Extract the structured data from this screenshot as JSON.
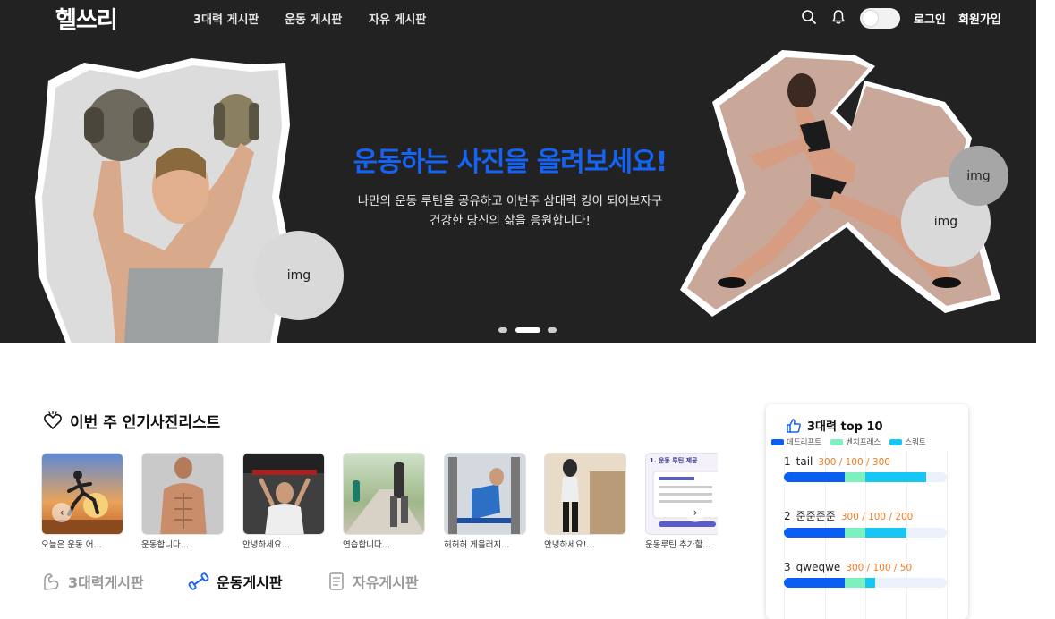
{
  "nav": {
    "logo": "헬쓰리",
    "links": [
      "3대력 게시판",
      "운동 게시판",
      "자유 게시판"
    ],
    "login": "로그인",
    "signup": "회원가입",
    "icons": [
      "search-icon",
      "bell-icon",
      "theme-toggle"
    ]
  },
  "hero": {
    "title": "운동하는 사진을 올려보세요!",
    "subtitle_line1": "나만의 운동 루틴을 공유하고 이번주 삼대력 킹이 되어보자구",
    "subtitle_line2": "건강한 당신의 삶을 응원합니다!",
    "img_labels": [
      "img",
      "img",
      "img"
    ],
    "active_slide": 1,
    "slide_count": 3
  },
  "popular": {
    "title": "이번 주 인기사진리스트",
    "items": [
      {
        "caption": "오늘은 운동 어..."
      },
      {
        "caption": "운동합니다..."
      },
      {
        "caption": "안녕하세요..."
      },
      {
        "caption": "연습합니다..."
      },
      {
        "caption": "허허허 게을러지..."
      },
      {
        "caption": "안녕하세요!..."
      },
      {
        "caption": "운동루틴 추가할..."
      }
    ],
    "prev": "‹",
    "next": "›",
    "last_thumb_text": "1. 운동 루틴 제공"
  },
  "tabs": {
    "items": [
      "3대력게시판",
      "운동게시판",
      "자유게시판"
    ],
    "active": 1
  },
  "top10": {
    "title": "3대력 top 10",
    "legend": [
      {
        "label": "데드리프트",
        "color": "#0a5ff2"
      },
      {
        "label": "벤치프레스",
        "color": "#7df0c0"
      },
      {
        "label": "스쿼트",
        "color": "#16c6f5"
      }
    ],
    "ranks": [
      {
        "rank": "1",
        "name": "tail",
        "values": "300 / 100 / 300",
        "dead": 300,
        "bench": 100,
        "squat": 300
      },
      {
        "rank": "2",
        "name": "준준준준",
        "values": "300 / 100 / 200",
        "dead": 300,
        "bench": 100,
        "squat": 200
      },
      {
        "rank": "3",
        "name": "qweqwe",
        "values": "300 / 100 / 50",
        "dead": 300,
        "bench": 100,
        "squat": 50
      }
    ],
    "scale_max": 800
  }
}
